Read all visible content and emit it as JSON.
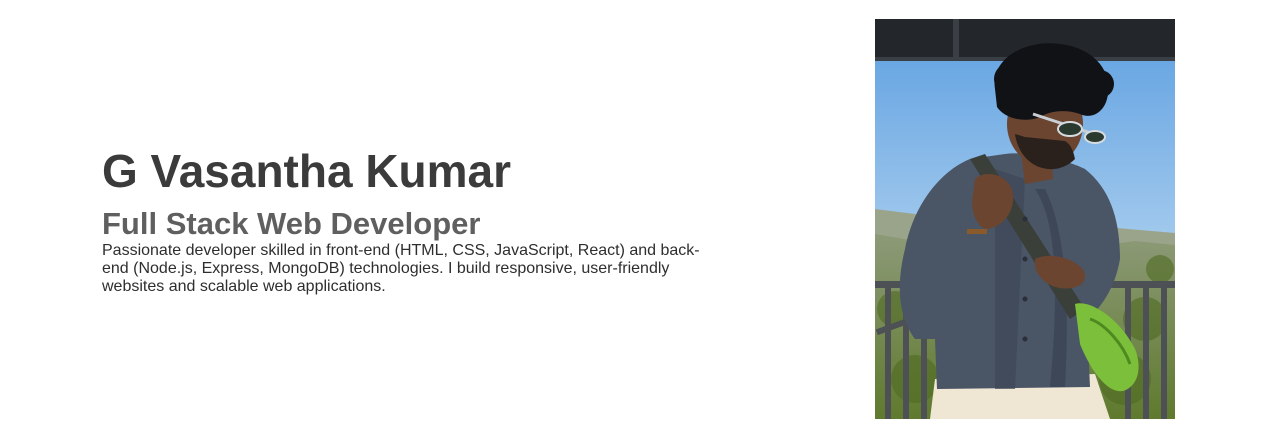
{
  "profile": {
    "name": "G Vasantha Kumar",
    "role": "Full Stack Web Developer",
    "bio": "Passionate developer skilled in front-end (HTML, CSS, JavaScript, React) and back-end (Node.js, Express, MongoDB) technologies. I build responsive, user-friendly websites and scalable web applications."
  },
  "photo": {
    "icon": "profile-photo",
    "colors": {
      "sky": "#7fb4e6",
      "roof": "#262a30",
      "shirt": "#4a5566",
      "trousers": "#efe6d4",
      "bag": "#7cbf3a",
      "railing": "#55585c",
      "hills": "#8a9a70",
      "foliage": "#6f8a3c"
    }
  }
}
